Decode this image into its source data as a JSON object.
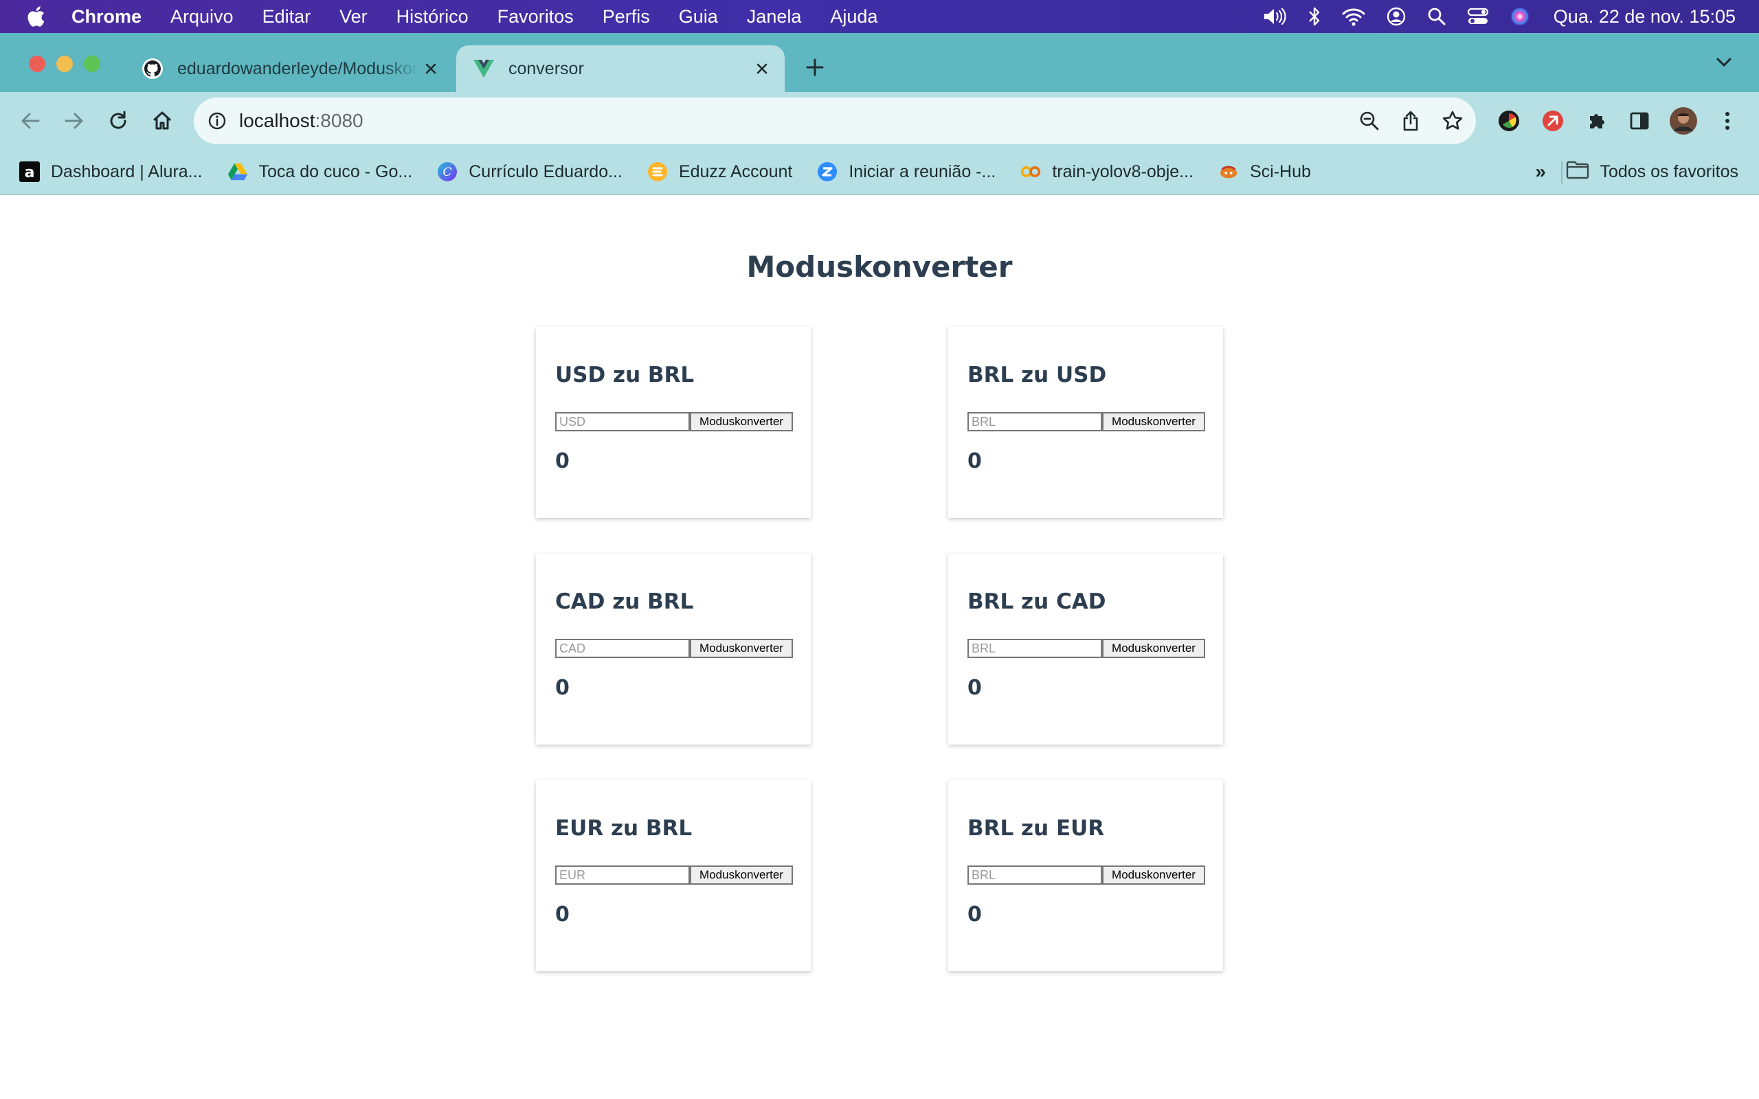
{
  "menubar": {
    "app": "Chrome",
    "items": [
      "Arquivo",
      "Editar",
      "Ver",
      "Histórico",
      "Favoritos",
      "Perfis",
      "Guia",
      "Janela",
      "Ajuda"
    ],
    "clock": "Qua. 22 de nov.  15:05"
  },
  "tabs": [
    {
      "title": "eduardowanderleyde/Moduskonverter",
      "icon": "github-icon"
    },
    {
      "title": "conversor",
      "icon": "vue-icon"
    }
  ],
  "address": {
    "host": "localhost",
    "port": ":8080"
  },
  "bookmarks": {
    "items": [
      {
        "label": "Dashboard | Alura...",
        "icon": "alura-icon"
      },
      {
        "label": "Toca do cuco - Go...",
        "icon": "drive-icon"
      },
      {
        "label": "Currículo Eduardo...",
        "icon": "canva-icon"
      },
      {
        "label": "Eduzz Account",
        "icon": "eduzz-icon"
      },
      {
        "label": "Iniciar a reunião -...",
        "icon": "zoom-icon"
      },
      {
        "label": "train-yolov8-obje...",
        "icon": "colab-icon"
      },
      {
        "label": "Sci-Hub",
        "icon": "scihub-icon"
      }
    ],
    "more": "»",
    "all": "Todos os favoritos"
  },
  "page": {
    "title": "Moduskonverter",
    "cards": [
      {
        "title": "USD zu BRL",
        "placeholder": "USD",
        "button": "Moduskonverter",
        "result": "0"
      },
      {
        "title": "BRL zu USD",
        "placeholder": "BRL",
        "button": "Moduskonverter",
        "result": "0"
      },
      {
        "title": "CAD zu BRL",
        "placeholder": "CAD",
        "button": "Moduskonverter",
        "result": "0"
      },
      {
        "title": "BRL zu CAD",
        "placeholder": "BRL",
        "button": "Moduskonverter",
        "result": "0"
      },
      {
        "title": "EUR zu BRL",
        "placeholder": "EUR",
        "button": "Moduskonverter",
        "result": "0"
      },
      {
        "title": "BRL zu EUR",
        "placeholder": "BRL",
        "button": "Moduskonverter",
        "result": "0"
      }
    ]
  },
  "colors": {
    "heading": "#2c3e50",
    "tabstrip": "#5eb7c1",
    "toolbar": "#b7e0e4",
    "menubar": "#3f2fa8"
  }
}
